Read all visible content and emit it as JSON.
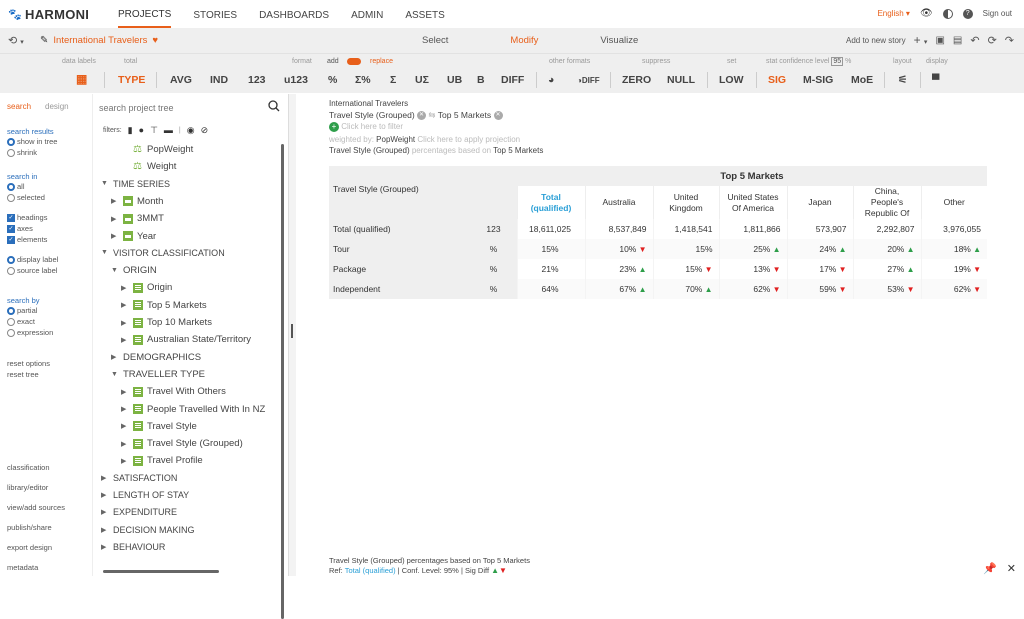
{
  "app": {
    "logo": "HARMONI",
    "nav": [
      "PROJECTS",
      "STORIES",
      "DASHBOARDS",
      "ADMIN",
      "ASSETS"
    ],
    "language": "English",
    "signout": "Sign out"
  },
  "bar2": {
    "story_name": "International Travelers",
    "modes": [
      "Select",
      "Modify",
      "Visualize"
    ],
    "active_mode": "Modify",
    "add_to_story": "Add to new story"
  },
  "ribbon": {
    "labels": {
      "data_labels": "data labels",
      "total": "total",
      "format": "format",
      "add": "add",
      "replace": "replace",
      "other_formats": "other formats",
      "suppress": "suppress",
      "set": "set",
      "stat_conf": "stat confidence level",
      "conf_value": "95",
      "percent": "%",
      "layout": "layout",
      "display": "display"
    },
    "buttons": {
      "type": "TYPE",
      "avg": "AVG",
      "ind": "IND",
      "n123": "123",
      "u123": "u123",
      "pct": "%",
      "sum_pct": "Σ%",
      "sum": "Σ",
      "u_sum": "UΣ",
      "ub": "UB",
      "b": "B",
      "diff": "DIFF",
      "zero": "ZERO",
      "null": "NULL",
      "low": "LOW",
      "sig": "SIG",
      "msig": "M-SIG",
      "moe": "MoE"
    }
  },
  "left_panel": {
    "tabs": [
      "search",
      "design"
    ],
    "search_results": "search results",
    "show_in_tree": "show in tree",
    "shrink": "shrink",
    "search_in": "search in",
    "all": "all",
    "selected": "selected",
    "headings": "headings",
    "axes": "axes",
    "elements": "elements",
    "display_label": "display label",
    "source_label": "source label",
    "search_by": "search by",
    "partial": "partial",
    "exact": "exact",
    "expression": "expression",
    "reset_options": "reset options",
    "reset_tree": "reset tree",
    "links": [
      "classification",
      "library/editor",
      "view/add sources",
      "publish/share",
      "export design",
      "metadata"
    ]
  },
  "tree": {
    "search_placeholder": "search project tree",
    "filters_label": "filters:",
    "items": [
      {
        "label": "PopWeight",
        "depth": 2,
        "icon": "weight",
        "arrow": ""
      },
      {
        "label": "Weight",
        "depth": 2,
        "icon": "weight",
        "arrow": ""
      },
      {
        "label": "TIME SERIES",
        "depth": 0,
        "icon": "",
        "arrow": "down"
      },
      {
        "label": "Month",
        "depth": 1,
        "icon": "cal",
        "arrow": "right"
      },
      {
        "label": "3MMT",
        "depth": 1,
        "icon": "cal",
        "arrow": "right"
      },
      {
        "label": "Year",
        "depth": 1,
        "icon": "cal",
        "arrow": "right"
      },
      {
        "label": "VISITOR CLASSIFICATION",
        "depth": 0,
        "icon": "",
        "arrow": "down"
      },
      {
        "label": "ORIGIN",
        "depth": 1,
        "icon": "",
        "arrow": "down"
      },
      {
        "label": "Origin",
        "depth": 2,
        "icon": "list",
        "arrow": "right"
      },
      {
        "label": "Top 5 Markets",
        "depth": 2,
        "icon": "list",
        "arrow": "right"
      },
      {
        "label": "Top 10 Markets",
        "depth": 2,
        "icon": "list",
        "arrow": "right"
      },
      {
        "label": "Australian State/Territory",
        "depth": 2,
        "icon": "list",
        "arrow": "right"
      },
      {
        "label": "DEMOGRAPHICS",
        "depth": 1,
        "icon": "",
        "arrow": "right"
      },
      {
        "label": "TRAVELLER TYPE",
        "depth": 1,
        "icon": "",
        "arrow": "down"
      },
      {
        "label": "Travel With Others",
        "depth": 2,
        "icon": "list",
        "arrow": "right"
      },
      {
        "label": "People Travelled With In NZ",
        "depth": 2,
        "icon": "list",
        "arrow": "right"
      },
      {
        "label": "Travel Style",
        "depth": 2,
        "icon": "list",
        "arrow": "right"
      },
      {
        "label": "Travel Style (Grouped)",
        "depth": 2,
        "icon": "list",
        "arrow": "right"
      },
      {
        "label": "Travel Profile",
        "depth": 2,
        "icon": "list",
        "arrow": "right"
      },
      {
        "label": "SATISFACTION",
        "depth": 0,
        "icon": "",
        "arrow": "right"
      },
      {
        "label": "LENGTH OF STAY",
        "depth": 0,
        "icon": "",
        "arrow": "right"
      },
      {
        "label": "EXPENDITURE",
        "depth": 0,
        "icon": "",
        "arrow": "right"
      },
      {
        "label": "DECISION MAKING",
        "depth": 0,
        "icon": "",
        "arrow": "right"
      },
      {
        "label": "BEHAVIOUR",
        "depth": 0,
        "icon": "",
        "arrow": "right"
      }
    ]
  },
  "summary": {
    "project": "International Travelers",
    "rows": "Travel Style (Grouped)",
    "cols": "Top 5 Markets",
    "filter_hint": "Click here to filter",
    "weighted_by_label": "weighted by:",
    "weight": "PopWeight",
    "projection_hint": "Click here to apply projection",
    "pct_prefix": "Travel Style (Grouped)",
    "pct_mid": "percentages based on",
    "pct_suffix": "Top 5 Markets"
  },
  "table": {
    "corner": "Travel Style (Grouped)",
    "col_group": "Top 5 Markets",
    "columns": [
      "Total (qualified)",
      "Australia",
      "United Kingdom",
      "United States Of America",
      "Japan",
      "China, People's Republic Of",
      "Other"
    ],
    "rows": [
      {
        "label": "Total (qualified)",
        "stat": "123",
        "values": [
          "18,611,025",
          "8,537,849",
          "1,418,541",
          "1,811,866",
          "573,907",
          "2,292,807",
          "3,976,055"
        ],
        "sig": [
          "",
          "",
          "",
          "",
          "",
          "",
          ""
        ]
      },
      {
        "label": "Tour",
        "stat": "%",
        "values": [
          "15%",
          "10%",
          "15%",
          "25%",
          "24%",
          "20%",
          "18%"
        ],
        "sig": [
          "",
          "down",
          "",
          "up",
          "up",
          "up",
          "up"
        ]
      },
      {
        "label": "Package",
        "stat": "%",
        "values": [
          "21%",
          "23%",
          "15%",
          "13%",
          "17%",
          "27%",
          "19%"
        ],
        "sig": [
          "",
          "up",
          "down",
          "down",
          "down",
          "up",
          "down"
        ]
      },
      {
        "label": "Independent",
        "stat": "%",
        "values": [
          "64%",
          "67%",
          "70%",
          "62%",
          "59%",
          "53%",
          "62%"
        ],
        "sig": [
          "",
          "up",
          "up",
          "down",
          "down",
          "down",
          "down"
        ]
      }
    ]
  },
  "footer": {
    "line1": "Travel Style (Grouped) percentages based on Top 5 Markets",
    "ref_label": "Ref:",
    "ref_value": "Total (qualified)",
    "conf": "Conf. Level: 95%",
    "sig": "Sig Diff"
  }
}
